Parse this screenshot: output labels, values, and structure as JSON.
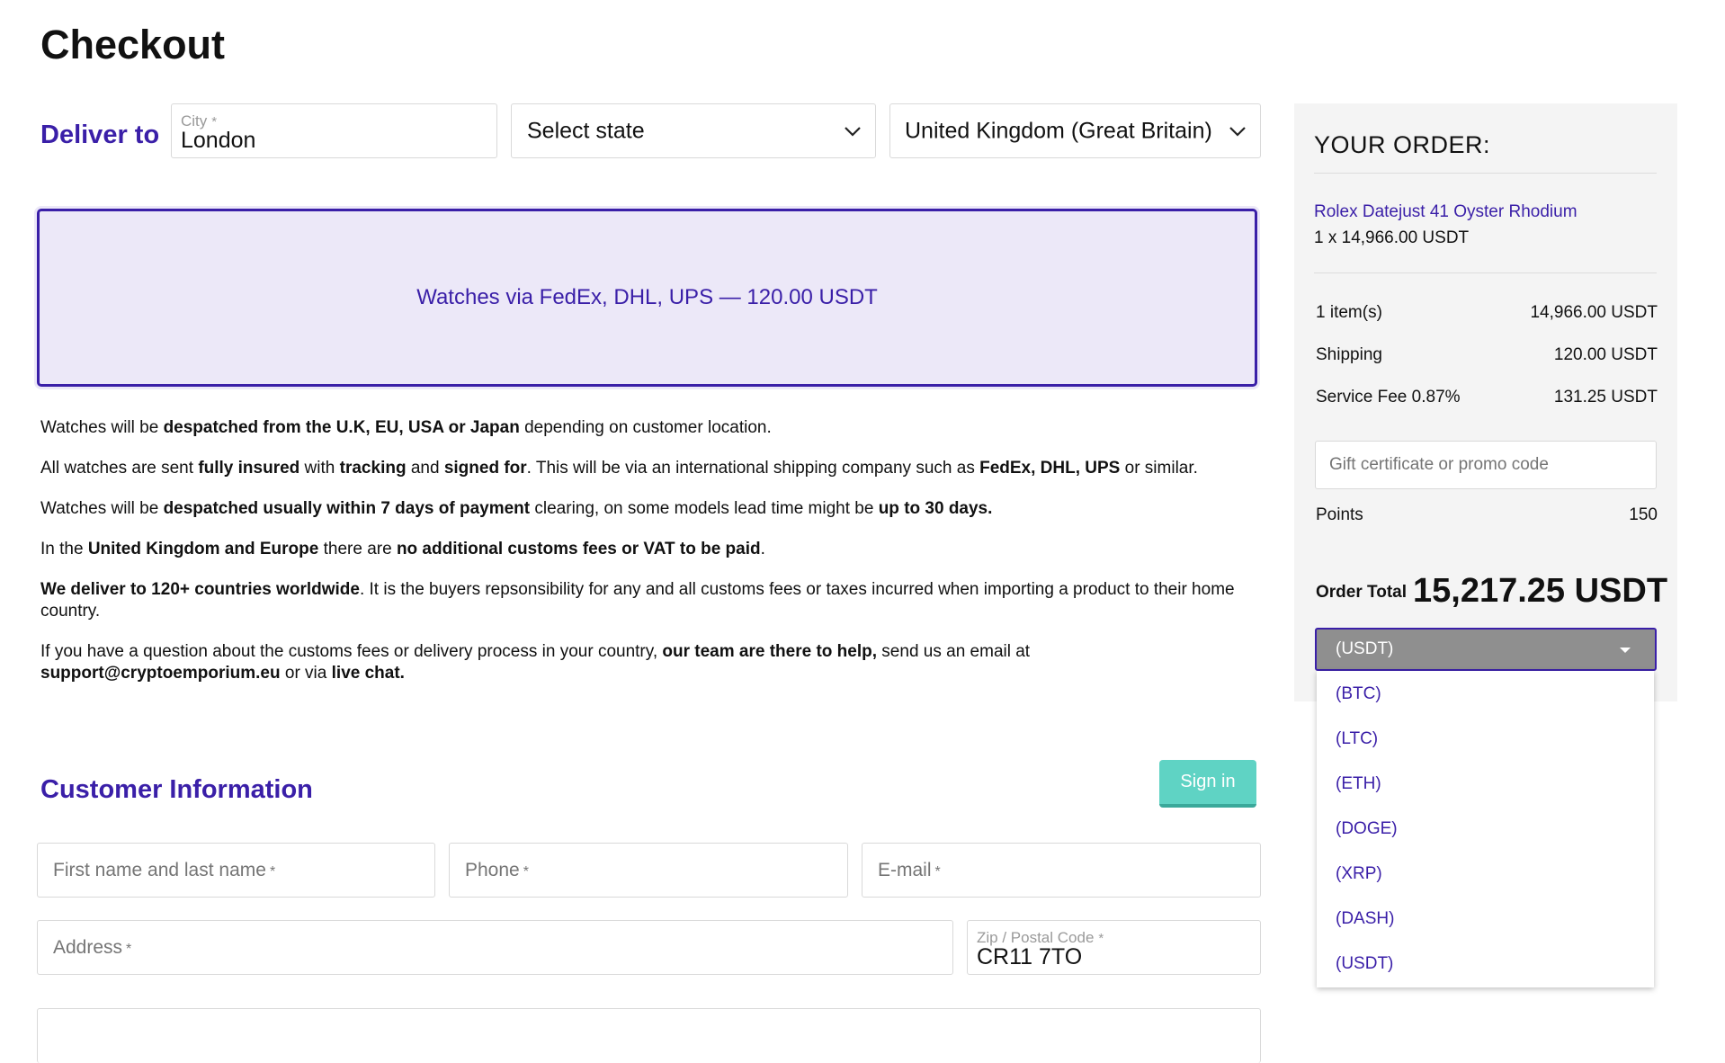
{
  "page": {
    "title": "Checkout"
  },
  "delivery": {
    "label": "Deliver to",
    "city": {
      "label": "City",
      "required_mark": "*",
      "value": "London"
    },
    "state": {
      "value": "Select state"
    },
    "country": {
      "value": "United Kingdom (Great Britain)"
    },
    "shipping_option": "Watches via FedEx, DHL, UPS — 120.00 USDT"
  },
  "info": {
    "p1": [
      "Watches will be ",
      "despatched from the U.K, EU, USA or Japan",
      " depending on customer location."
    ],
    "p2": [
      "All watches are sent ",
      "fully insured",
      " with ",
      "tracking",
      " and ",
      "signed for",
      ". This will be via an international shipping company such as ",
      "FedEx, DHL, UPS",
      " or similar."
    ],
    "p3": [
      "Watches will be ",
      "despatched usually within 7 days of payment",
      " clearing, on some models lead time might be ",
      "up to 30 days."
    ],
    "p4": [
      "In the ",
      "United Kingdom and Europe",
      " there are ",
      "no additional customs fees or VAT to be paid",
      "."
    ],
    "p5": [
      "We deliver to 120+ countries worldwide",
      ". It is the buyers repsonsibility for any and all customs fees or taxes incurred when importing a product to their home country."
    ],
    "p6": [
      "If you have a question about the customs fees or delivery process in your country, ",
      "our team are there to help,",
      " send us an email at ",
      "support@cryptoemporium.eu",
      " or via ",
      "live chat."
    ]
  },
  "customer": {
    "label": "Customer Information",
    "sign_in": "Sign in",
    "name_placeholder": "First name and last name",
    "phone_placeholder": "Phone",
    "email_placeholder": "E-mail",
    "address_placeholder": "Address",
    "required_mark": "*",
    "zip": {
      "label": "Zip / Postal Code",
      "value": "CR11 7TO"
    }
  },
  "order": {
    "title": "YOUR ORDER:",
    "product_name": "Rolex Datejust 41 Oyster Rhodium",
    "product_qty": "1 x 14,966.00 USDT",
    "items_label": "1 item(s)",
    "items_value": "14,966.00 USDT",
    "shipping_label": "Shipping",
    "shipping_value": "120.00 USDT",
    "fee_label": "Service Fee 0.87%",
    "fee_value": "131.25 USDT",
    "promo_placeholder": "Gift certificate or promo code",
    "points_label": "Points",
    "points_value": "150",
    "total_label": "Order Total",
    "total_value": "15,217.25 USDT",
    "currency_selected": "(USDT)",
    "currency_options": [
      "(BTC)",
      "(LTC)",
      "(ETH)",
      "(DOGE)",
      "(XRP)",
      "(DASH)",
      "(USDT)"
    ]
  },
  "colors": {
    "accent": "#3a1fa8",
    "shipping_bg": "#ece8f8",
    "sign_in_button": "#5fd3c4",
    "panel_bg": "#f4f4f4"
  }
}
